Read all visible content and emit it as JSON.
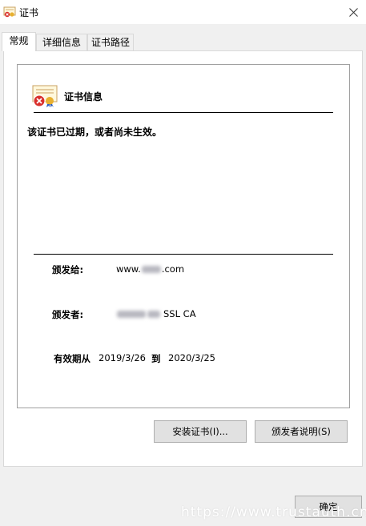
{
  "window": {
    "title": "证书"
  },
  "tabs": [
    {
      "label": "常规"
    },
    {
      "label": "详细信息"
    },
    {
      "label": "证书路径"
    }
  ],
  "cert_info": {
    "heading": "证书信息",
    "status": "该证书已过期，或者尚未生效。",
    "issued_to": {
      "label": "颁发给:",
      "value_prefix": "www.",
      "value_suffix": ".com"
    },
    "issued_by": {
      "label": "颁发者:",
      "value_suffix": "SSL CA"
    },
    "validity": {
      "label_from": "有效期从",
      "from": "2019/3/26",
      "label_to": "到",
      "to": "2020/3/25"
    }
  },
  "buttons": {
    "install": "安装证书(I)...",
    "issuer_statement": "颁发者说明(S)",
    "ok": "确定"
  },
  "watermark": "https://www.trustauth.cn",
  "icons": {
    "title": "certificate-error-icon",
    "close": "close-icon",
    "cert": "certificate-error-icon"
  }
}
